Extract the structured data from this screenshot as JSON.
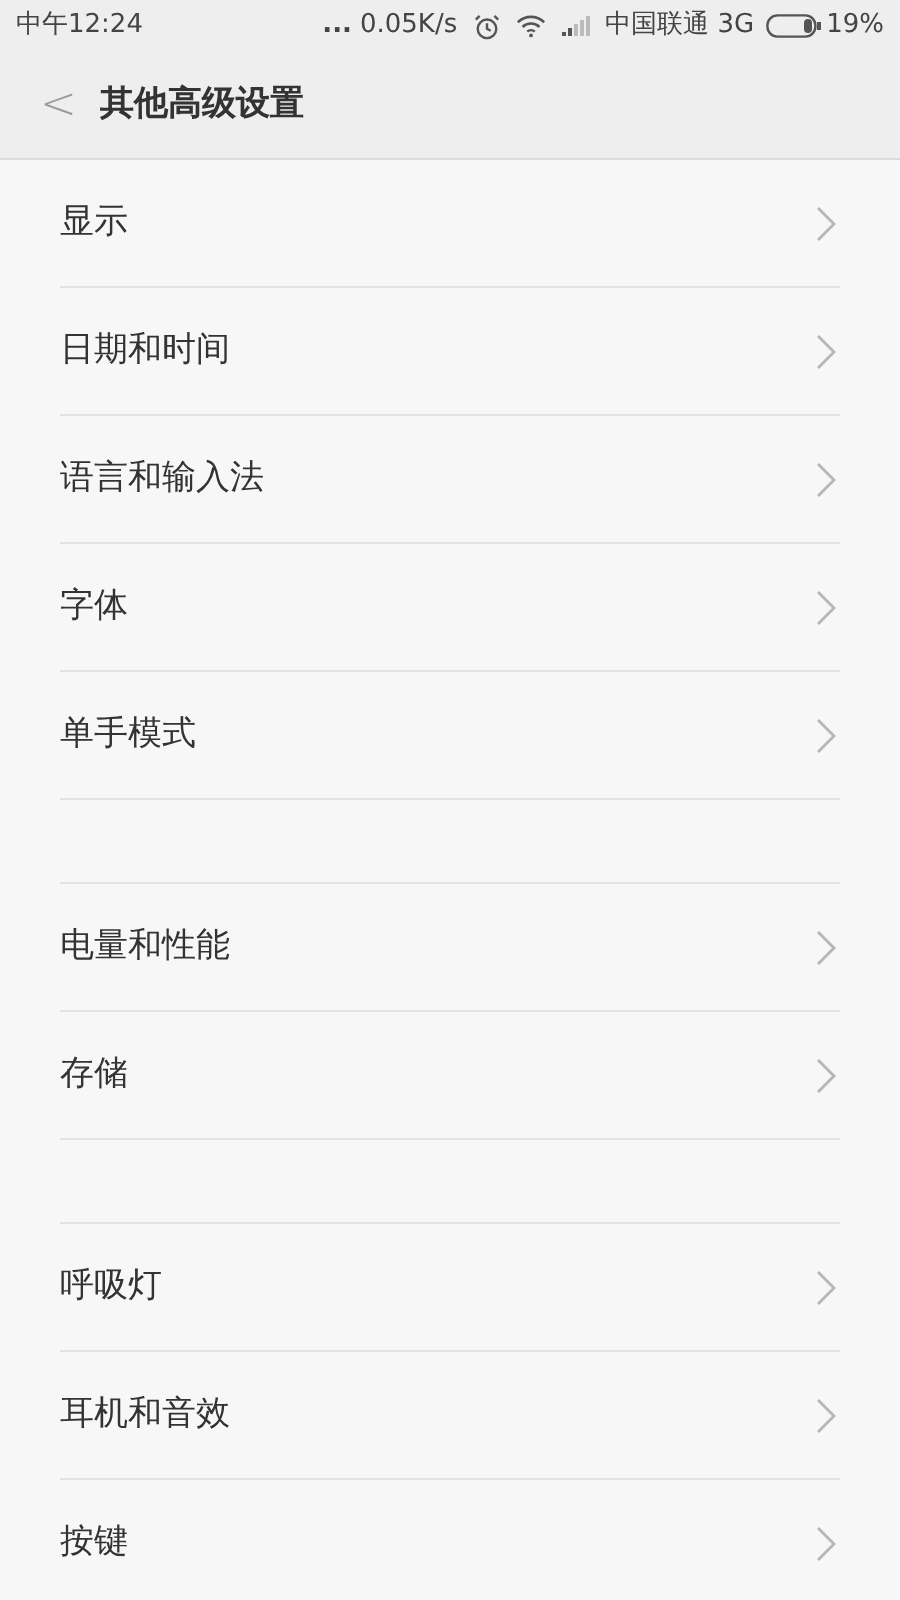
{
  "status_bar": {
    "time": "中午12:24",
    "dots": "...",
    "speed": "0.05K/s",
    "carrier": "中国联通 3G",
    "battery": "19%"
  },
  "header": {
    "back": "<",
    "title": "其他高级设置"
  },
  "groups": [
    {
      "items": [
        {
          "label": "显示"
        },
        {
          "label": "日期和时间"
        },
        {
          "label": "语言和输入法"
        },
        {
          "label": "字体"
        },
        {
          "label": "单手模式"
        }
      ]
    },
    {
      "items": [
        {
          "label": "电量和性能"
        },
        {
          "label": "存储"
        }
      ]
    },
    {
      "items": [
        {
          "label": "呼吸灯"
        },
        {
          "label": "耳机和音效"
        },
        {
          "label": "按键"
        }
      ]
    }
  ]
}
